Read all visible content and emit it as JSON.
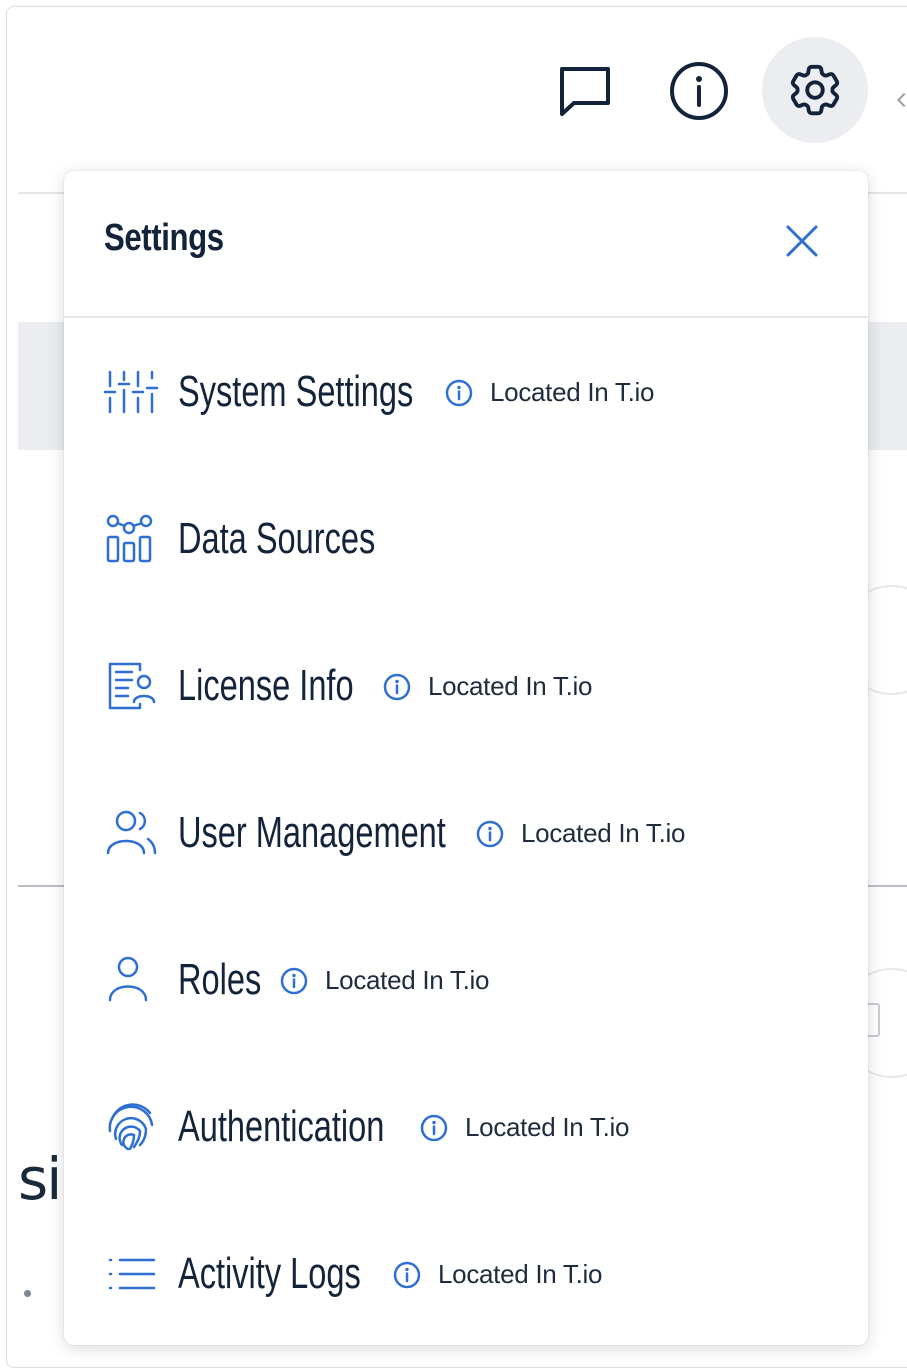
{
  "colors": {
    "accent": "#2f6fd1",
    "text": "#13233a"
  },
  "toolbar": {
    "icons": [
      "chat-icon",
      "info-icon",
      "gear-icon"
    ]
  },
  "background": {
    "partial_text": "si"
  },
  "settings": {
    "title": "Settings",
    "close_icon": "close-icon",
    "items": [
      {
        "label": "System Settings",
        "icon": "sliders-icon",
        "note": "Located In T.io"
      },
      {
        "label": "Data Sources",
        "icon": "data-sources-icon",
        "note": ""
      },
      {
        "label": "License Info",
        "icon": "license-icon",
        "note": "Located In T.io"
      },
      {
        "label": "User Management",
        "icon": "users-icon",
        "note": "Located In T.io"
      },
      {
        "label": "Roles",
        "icon": "user-icon",
        "note": "Located In T.io"
      },
      {
        "label": "Authentication",
        "icon": "fingerprint-icon",
        "note": "Located In T.io"
      },
      {
        "label": "Activity Logs",
        "icon": "list-icon",
        "note": "Located In T.io"
      }
    ]
  }
}
